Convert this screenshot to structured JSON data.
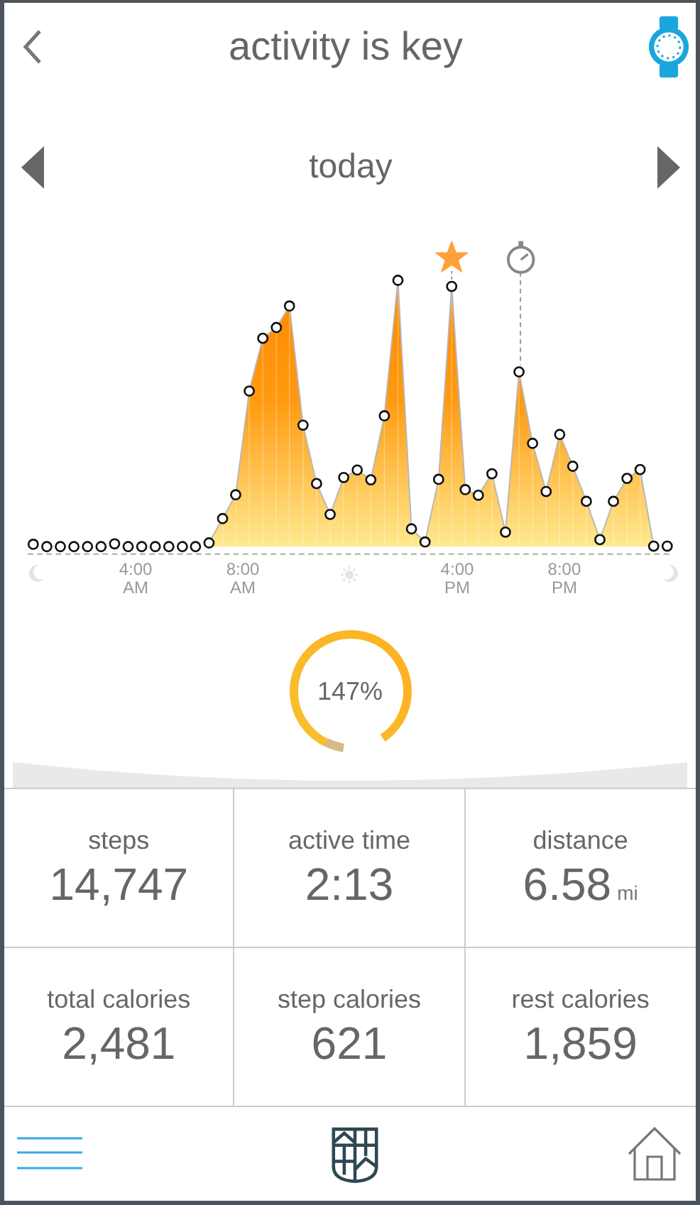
{
  "header": {
    "title": "activity is key"
  },
  "date_nav": {
    "label": "today"
  },
  "chart": {
    "axis_labels": [
      {
        "time": "4:00",
        "period": "AM"
      },
      {
        "time": "8:00",
        "period": "AM"
      },
      {
        "time": "4:00",
        "period": "PM"
      },
      {
        "time": "8:00",
        "period": "PM"
      }
    ]
  },
  "goal": {
    "percent": "147%"
  },
  "stats": [
    {
      "label": "steps",
      "value": "14,747"
    },
    {
      "label": "active time",
      "value": "2:13"
    },
    {
      "label": "distance",
      "value": "6.58",
      "unit": "mi"
    },
    {
      "label": "total calories",
      "value": "2,481"
    },
    {
      "label": "step calories",
      "value": "621"
    },
    {
      "label": "rest calories",
      "value": "1,859"
    }
  ]
}
